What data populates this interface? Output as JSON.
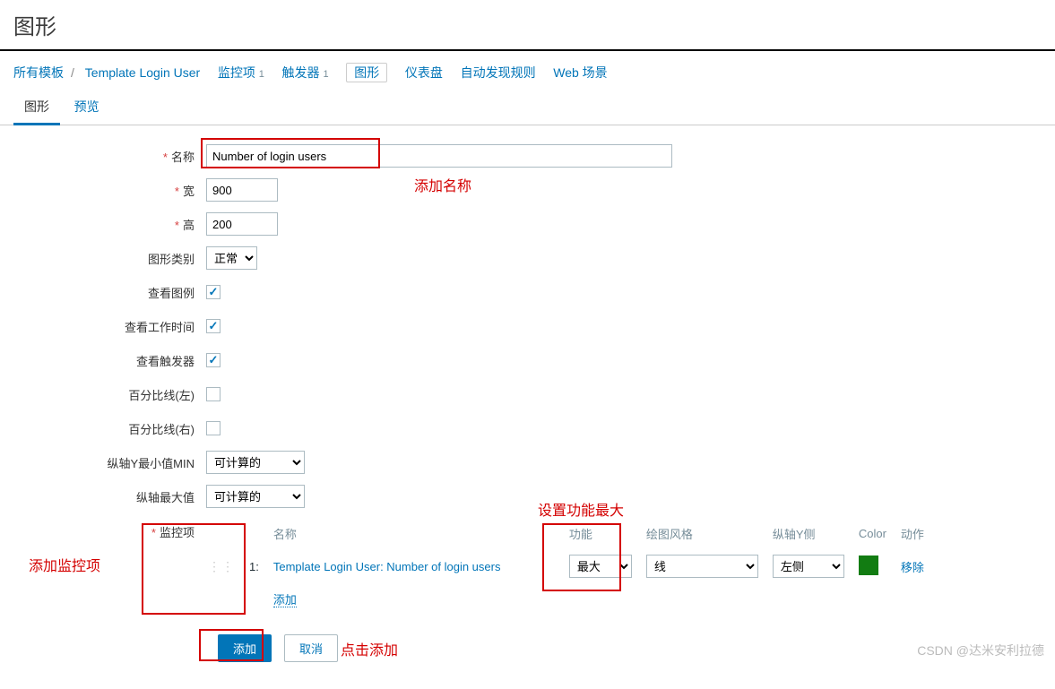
{
  "header": {
    "title": "图形"
  },
  "breadcrumbs": {
    "all_templates": "所有模板",
    "template_name": "Template Login User",
    "items": "监控项",
    "items_count": "1",
    "triggers": "触发器",
    "triggers_count": "1",
    "graphs": "图形",
    "dashboards": "仪表盘",
    "discovery": "自动发现规则",
    "web": "Web 场景"
  },
  "tabs": {
    "graph": "图形",
    "preview": "预览"
  },
  "form": {
    "name_label": "名称",
    "name_value": "Number of login users",
    "width_label": "宽",
    "width_value": "900",
    "height_label": "高",
    "height_value": "200",
    "type_label": "图形类别",
    "type_value": "正常",
    "legend_label": "查看图例",
    "worktime_label": "查看工作时间",
    "triggers_label": "查看触发器",
    "percent_left_label": "百分比线(左)",
    "percent_right_label": "百分比线(右)",
    "ymin_label": "纵轴Y最小值MIN",
    "ymin_value": "可计算的",
    "ymax_label": "纵轴最大值",
    "ymax_value": "可计算的",
    "items_label": "监控项"
  },
  "items_table": {
    "col_name": "名称",
    "col_func": "功能",
    "col_draw": "绘图风格",
    "col_yaxis": "纵轴Y侧",
    "col_color": "Color",
    "col_action": "动作",
    "row_num": "1:",
    "row_name": "Template Login User: Number of login users",
    "row_func": "最大",
    "row_draw": "线",
    "row_yaxis": "左侧",
    "row_remove": "移除",
    "add_link": "添加"
  },
  "buttons": {
    "add": "添加",
    "cancel": "取消"
  },
  "annotations": {
    "add_name": "添加名称",
    "add_item": "添加监控项",
    "set_func": "设置功能最大",
    "click_add": "点击添加"
  },
  "watermark": "CSDN @达米安利拉德"
}
